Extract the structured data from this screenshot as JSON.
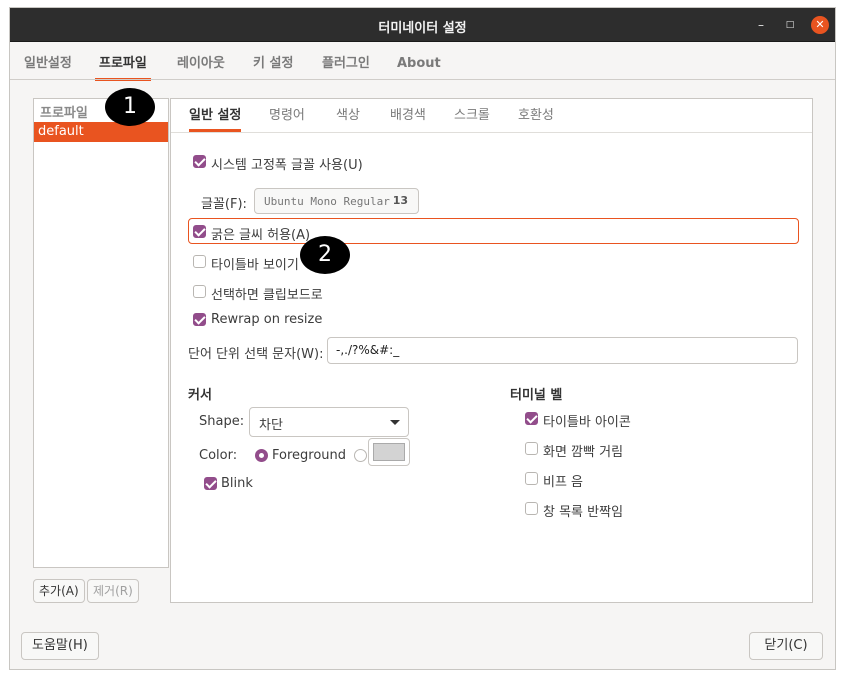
{
  "window": {
    "title": "터미네이터 설정",
    "minimize_glyph": "–",
    "maximize_glyph": "□",
    "close_glyph": "✕"
  },
  "main_tabs": [
    {
      "label": "일반설정"
    },
    {
      "label": "프로파일"
    },
    {
      "label": "레이아웃"
    },
    {
      "label": "키 설정"
    },
    {
      "label": "플러그인"
    },
    {
      "label": "About"
    }
  ],
  "profiles": {
    "header": "프로파일",
    "items": [
      "default"
    ],
    "add_label": "추가(A)",
    "remove_label": "제거(R)"
  },
  "sub_tabs": [
    {
      "label": "일반 설정"
    },
    {
      "label": "명령어"
    },
    {
      "label": "색상"
    },
    {
      "label": "배경색"
    },
    {
      "label": "스크롤"
    },
    {
      "label": "호환성"
    }
  ],
  "general": {
    "system_font_label": "시스템 고정폭 글꼴 사용(U)",
    "font_label": "글꼴(F):",
    "font_name": "Ubuntu Mono Regular",
    "font_size": "13",
    "bold_label": "굵은 글씨 허용(A)",
    "titlebar_label": "타이틀바 보이기",
    "copy_on_select_label": "선택하면 클립보드로",
    "rewrap_label": "Rewrap on resize",
    "word_chars_label": "단어 단위 선택 문자(W):",
    "word_chars_value": "-,./?%&#:_"
  },
  "cursor": {
    "section_label": "커서",
    "shape_label": "Shape:",
    "shape_value": "차단",
    "color_label": "Color:",
    "foreground_label": "Foreground",
    "swatch_color": "#d3d3d3",
    "blink_label": "Blink"
  },
  "bell": {
    "section_label": "터미널 벨",
    "icon_label": "타이틀바 아이콘",
    "flash_label": "화면 깜빡 거림",
    "beep_label": "비프 음",
    "urgent_label": "창 목록 반짝임"
  },
  "footer": {
    "help_label": "도움말(H)",
    "close_label": "닫기(C)"
  },
  "markers": [
    "1",
    "2"
  ],
  "colors": {
    "accent": "#e95420",
    "checkbox": "#924d8b",
    "titlebar": "#2d2d2d"
  }
}
